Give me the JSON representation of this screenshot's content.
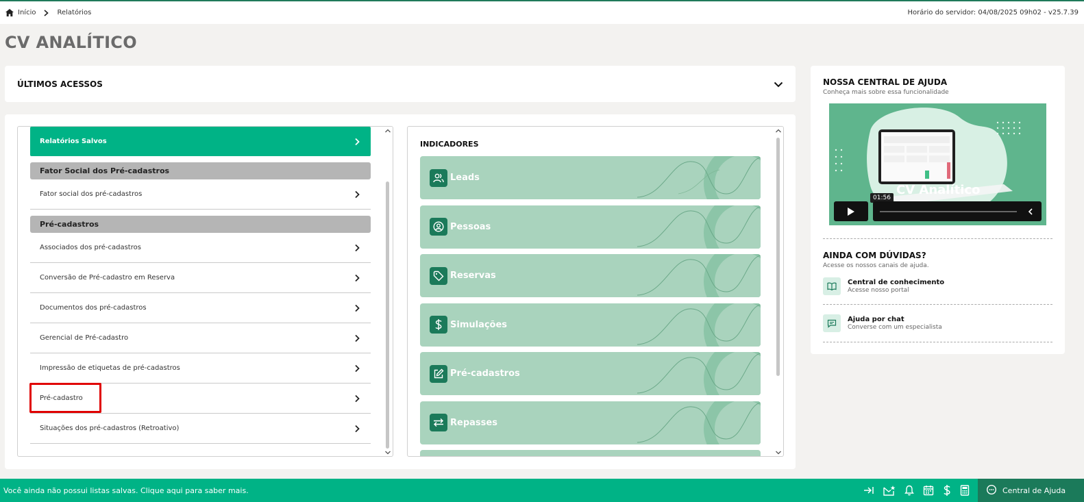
{
  "breadcrumb": {
    "home": "Início",
    "current": "Relatórios"
  },
  "server_time": "Horário do servidor: 04/08/2025 09h02 - v25.7.39",
  "page_title": "CV ANALÍTICO",
  "last_access": {
    "label": "ÚLTIMOS ACESSOS"
  },
  "reports": {
    "saved_label": "Relatórios Salvos",
    "groups": [
      {
        "title": "Fator Social dos Pré-cadastros",
        "items": [
          "Fator social dos pré-cadastros"
        ]
      },
      {
        "title": "Pré-cadastros",
        "items": [
          "Associados dos pré-cadastros",
          "Conversão de Pré-cadastro em Reserva",
          "Documentos dos pré-cadastros",
          "Gerencial de Pré-cadastro",
          "Impressão de etiquetas de pré-cadastros",
          "Pré-cadastro",
          "Situações dos pré-cadastros (Retroativo)"
        ]
      }
    ]
  },
  "indicators": {
    "title": "INDICADORES",
    "items": [
      {
        "label": "Leads",
        "icon": "users-icon"
      },
      {
        "label": "Pessoas",
        "icon": "person-circle-icon"
      },
      {
        "label": "Reservas",
        "icon": "tag-icon"
      },
      {
        "label": "Simulações",
        "icon": "dollar-icon"
      },
      {
        "label": "Pré-cadastros",
        "icon": "edit-icon"
      },
      {
        "label": "Repasses",
        "icon": "transfer-icon"
      }
    ]
  },
  "help": {
    "title": "NOSSA CENTRAL DE AJUDA",
    "subtitle": "Conheça mais sobre essa funcionalidade",
    "video_title": "CV Analítico",
    "video_time": "01:56",
    "doubts_title": "AINDA COM DÚVIDAS?",
    "doubts_subtitle": "Acesse os nossos canais de ajuda.",
    "channels": [
      {
        "title": "Central de conhecimento",
        "subtitle": "Acesse nosso portal",
        "icon": "book-icon"
      },
      {
        "title": "Ajuda por chat",
        "subtitle": "Converse com um especialista",
        "icon": "chat-icon"
      }
    ]
  },
  "bottom_bar": {
    "message": "Você ainda não possui listas salvas. Clique aqui para saber mais.",
    "help_center": "Central de Ajuda"
  },
  "colors": {
    "brand": "#00b386",
    "brand_dark": "#1b7a5a",
    "indicator_bg": "#a9d3bd",
    "highlight": "#e00000"
  }
}
